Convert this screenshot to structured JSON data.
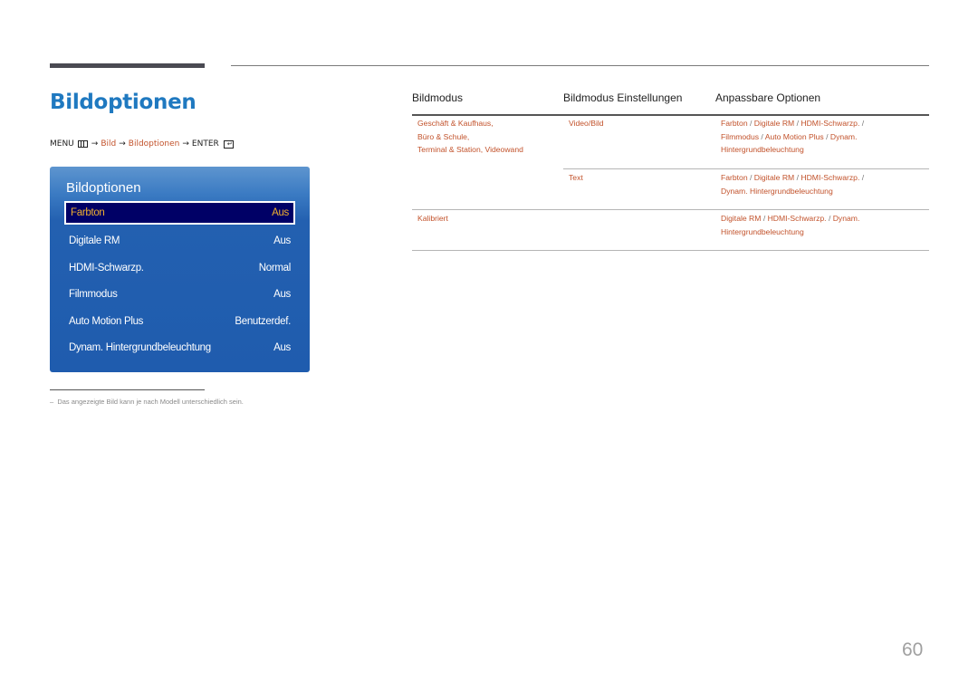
{
  "header": {
    "title": "Bildoptionen"
  },
  "breadcrumb": {
    "menu_label": "MENU",
    "arrow": "→",
    "items": [
      "Bild",
      "Bildoptionen"
    ],
    "enter_label": "ENTER",
    "menu_icon": "menu-grid-icon",
    "enter_icon": "enter-return-icon"
  },
  "osd_menu": {
    "title": "Bildoptionen",
    "items": [
      {
        "label": "Farbton",
        "value": "Aus",
        "selected": true
      },
      {
        "label": "Digitale RM",
        "value": "Aus"
      },
      {
        "label": "HDMI-Schwarzp.",
        "value": "Normal"
      },
      {
        "label": "Filmmodus",
        "value": "Aus"
      },
      {
        "label": "Auto Motion Plus",
        "value": "Benutzerdef."
      },
      {
        "label": "Dynam. Hintergrundbeleuchtung",
        "value": "Aus"
      }
    ],
    "colors": {
      "panel": "#1f5cae",
      "selected_bg": "#000066",
      "selected_text": "#f0b030"
    }
  },
  "footnote": {
    "dash": "–",
    "text": "Das angezeigte Bild kann je nach Modell unterschiedlich sein."
  },
  "table": {
    "headers": [
      "Bildmodus",
      "Bildmodus Einstellungen",
      "Anpassbare Optionen"
    ],
    "rows": [
      {
        "mode": [
          "Geschäft & Kaufhaus,",
          "Büro & Schule,",
          "Terminal & Station, Videowand"
        ],
        "setting": "Video/Bild",
        "options_lines": [
          [
            "Farbton",
            "Digitale RM",
            "HDMI-Schwarzp."
          ],
          [
            "Filmmodus",
            "Auto Motion Plus",
            "Dynam."
          ],
          [
            "Hintergrundbeleuchtung"
          ]
        ]
      },
      {
        "mode": [],
        "setting": "Text",
        "options_lines": [
          [
            "Farbton",
            "Digitale RM",
            "HDMI-Schwarzp."
          ],
          [
            "Dynam. Hintergrundbeleuchtung"
          ]
        ]
      },
      {
        "mode": [
          "Kalibriert"
        ],
        "setting": "",
        "options_lines": [
          [
            "Digitale RM",
            "HDMI-Schwarzp.",
            "Dynam."
          ],
          [
            "Hintergrundbeleuchtung"
          ]
        ]
      }
    ],
    "separator": "/",
    "colors": {
      "link_text": "#c2522b",
      "title_blue": "#1f79c0"
    }
  },
  "page_number": "60"
}
